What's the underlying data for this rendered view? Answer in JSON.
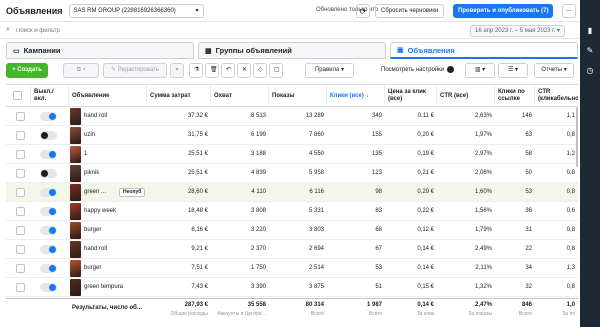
{
  "header": {
    "title": "Объявления",
    "account": "SAS RM GROUP (229816926366360)",
    "updated": "Обновлено только что",
    "reset_label": "Сбросить черновики",
    "publish_label": "Проверить и опубликовать (7)",
    "more_label": "..."
  },
  "search": {
    "placeholder": "Поиск и фильтр",
    "date_range": "16 апр 2023 г. – 5 мая 2023 г."
  },
  "tabs": [
    {
      "label": "Кампании"
    },
    {
      "label": "Группы объявлений"
    },
    {
      "label": "Объявления"
    }
  ],
  "toolbar": {
    "create_label": "+ Создать",
    "edit_label": "Редактировать",
    "rules_label": "Правила",
    "preview_label": "Посмотреть настройки",
    "reports_label": "Отчеты"
  },
  "columns": {
    "toggle": "Выкл./вкл.",
    "ad": "Объявление",
    "spend": "Сумма затрат",
    "reach": "Охват",
    "impressions": "Показы",
    "clicks": "Клики (все)",
    "cpc": "Цена за клик (все)",
    "ctr": "CTR (все)",
    "link_clicks": "Клики по ссылке",
    "ctr_link": "CTR (кликабельно"
  },
  "rows": [
    {
      "on": true,
      "name": "hand roll",
      "badge": "",
      "spend": "37,32 €",
      "reach": "8 513",
      "impr": "13 289",
      "clicks": "349",
      "cpc": "0,11 €",
      "ctr": "2,63%",
      "lc": "146",
      "ctrl": "1,1",
      "thumb": "#6b3a2a",
      "hl": false
    },
    {
      "on": false,
      "name": "uzin",
      "badge": "",
      "spend": "31,75 €",
      "reach": "6 199",
      "impr": "7 860",
      "clicks": "155",
      "cpc": "0,20 €",
      "ctr": "1,97%",
      "lc": "63",
      "ctrl": "0,8",
      "thumb": "#8a4f3a",
      "hl": false
    },
    {
      "on": true,
      "name": "1",
      "badge": "",
      "spend": "25,51 €",
      "reach": "3 188",
      "impr": "4 550",
      "clicks": "135",
      "cpc": "0,19 €",
      "ctr": "2,97%",
      "lc": "58",
      "ctrl": "1,2",
      "thumb": "#c25a3d",
      "hl": false
    },
    {
      "on": false,
      "name": "piknik",
      "badge": "",
      "spend": "25,51 €",
      "reach": "4 839",
      "impr": "5 958",
      "clicks": "123",
      "cpc": "0,21 €",
      "ctr": "2,06%",
      "lc": "50",
      "ctrl": "0,8",
      "thumb": "#5e4636",
      "hl": false
    },
    {
      "on": true,
      "name": "green ...",
      "badge": "Неопуб",
      "spend": "28,60 €",
      "reach": "4 110",
      "impr": "6 116",
      "clicks": "98",
      "cpc": "0,29 €",
      "ctr": "1,60%",
      "lc": "53",
      "ctrl": "0,8",
      "thumb": "#7a2e22",
      "hl": true
    },
    {
      "on": true,
      "name": "happy week",
      "badge": "",
      "spend": "18,48 €",
      "reach": "3 808",
      "impr": "5 331",
      "clicks": "83",
      "cpc": "0,22 €",
      "ctr": "1,56%",
      "lc": "36",
      "ctrl": "0,6",
      "thumb": "#a13d2a",
      "hl": false
    },
    {
      "on": true,
      "name": "burger",
      "badge": "",
      "spend": "8,16 €",
      "reach": "3 220",
      "impr": "3 803",
      "clicks": "68",
      "cpc": "0,12 €",
      "ctr": "1,79%",
      "lc": "31",
      "ctrl": "0,8",
      "thumb": "#9a4b2c",
      "hl": false
    },
    {
      "on": true,
      "name": "hand roll",
      "badge": "",
      "spend": "9,21 €",
      "reach": "2 370",
      "impr": "2 694",
      "clicks": "67",
      "cpc": "0,14 €",
      "ctr": "2,49%",
      "lc": "22",
      "ctrl": "0,8",
      "thumb": "#6e3324",
      "hl": false
    },
    {
      "on": true,
      "name": "burger",
      "badge": "",
      "spend": "7,51 €",
      "reach": "1 750",
      "impr": "2 514",
      "clicks": "53",
      "cpc": "0,14 €",
      "ctr": "2,11%",
      "lc": "34",
      "ctrl": "1,3",
      "thumb": "#b55634",
      "hl": false
    },
    {
      "on": true,
      "name": "green tempura",
      "badge": "",
      "spend": "7,43 €",
      "reach": "3 390",
      "impr": "3 875",
      "clicks": "51",
      "cpc": "0,15 €",
      "ctr": "1,32%",
      "lc": "32",
      "ctrl": "0,8",
      "thumb": "#4a2a20",
      "hl": false
    }
  ],
  "footer": {
    "label": "Результаты, число об...",
    "spend": "287,93 €",
    "spend_sub": "Общие расходы",
    "reach": "35 558",
    "reach_sub": "Аккаунты в Центре...",
    "impr": "80 314",
    "impr_sub": "Всего",
    "clicks": "1 987",
    "clicks_sub": "Всего",
    "cpc": "0,14 €",
    "cpc_sub": "За клик",
    "ctr": "2,47%",
    "ctr_sub": "За показы",
    "lc": "846",
    "lc_sub": "Всего",
    "ctrl": "1,0",
    "ctrl_sub": "За по"
  },
  "colors": {
    "accent": "#1877f2",
    "create": "#42b72a",
    "sidebar": "#1c2b33"
  }
}
